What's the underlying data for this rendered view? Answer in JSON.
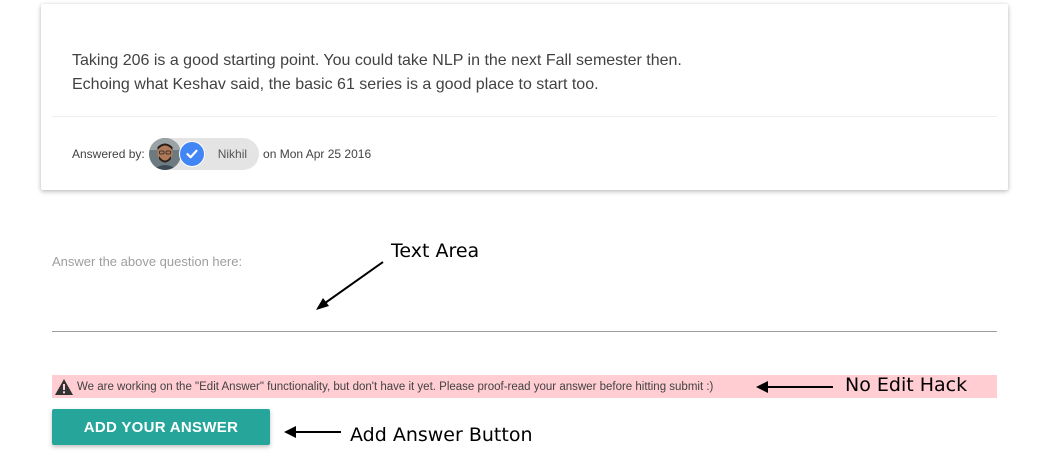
{
  "answer_card": {
    "lines": [
      "Taking 206 is a good starting point. You could take NLP in the next Fall semester then.",
      "Echoing what Keshav said, the basic 61 series is a good place to start too."
    ],
    "answered_by_label": "Answered by:",
    "author_name": "Nikhil",
    "date_text": "on Mon Apr 25 2016"
  },
  "answer_form": {
    "placeholder": "Answer the above question here:",
    "value": "",
    "warning_text": "We are working on the \"Edit Answer\" functionality, but don't have it yet. Please proof-read your answer before hitting submit :)",
    "submit_label": "ADD YOUR ANSWER"
  },
  "annotations": {
    "text_area": "Text Area",
    "no_edit_hack": "No Edit Hack",
    "add_answer_button": "Add Answer Button"
  },
  "colors": {
    "button": "#26a69a",
    "warning_bg": "#ffcdd2",
    "verified_badge": "#4285f4"
  },
  "icons": [
    "verified-check-icon",
    "warning-triangle-icon"
  ]
}
